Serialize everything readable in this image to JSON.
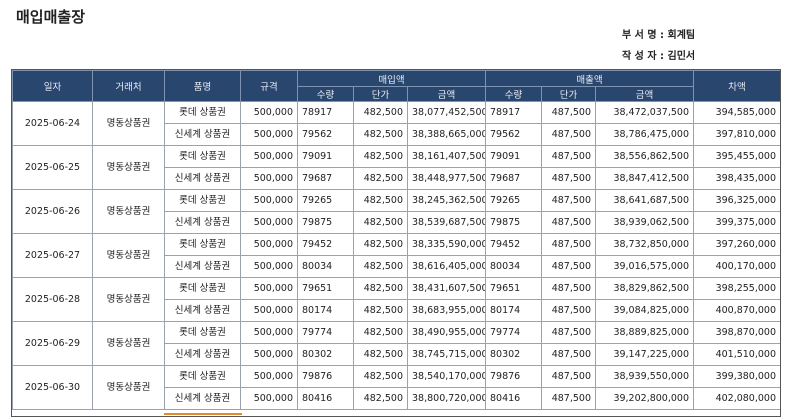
{
  "title": "매입매출장",
  "department": "부 서 명 : 회계팀",
  "author": "작 성 자 : 김민서",
  "headers": {
    "date": "일자",
    "vendor": "거래처",
    "item": "품명",
    "spec": "규격",
    "purchase": "매입액",
    "sales": "매출액",
    "margin": "차액",
    "qty": "수량",
    "unit_price": "단가",
    "amount": "금액"
  },
  "rows": [
    {
      "date": "2025-06-24",
      "vendor": "명동상품권",
      "items": [
        {
          "name": "롯데 상품권",
          "spec": "500,000",
          "p_qty": "78917",
          "p_price": "482,500",
          "p_amt": "38,077,452,500",
          "s_qty": "78917",
          "s_price": "487,500",
          "s_amt": "38,472,037,500",
          "margin": "394,585,000"
        },
        {
          "name": "신세계 상품권",
          "spec": "500,000",
          "p_qty": "79562",
          "p_price": "482,500",
          "p_amt": "38,388,665,000",
          "s_qty": "79562",
          "s_price": "487,500",
          "s_amt": "38,786,475,000",
          "margin": "397,810,000"
        }
      ]
    },
    {
      "date": "2025-06-25",
      "vendor": "명동상품권",
      "items": [
        {
          "name": "롯데 상품권",
          "spec": "500,000",
          "p_qty": "79091",
          "p_price": "482,500",
          "p_amt": "38,161,407,500",
          "s_qty": "79091",
          "s_price": "487,500",
          "s_amt": "38,556,862,500",
          "margin": "395,455,000"
        },
        {
          "name": "신세계 상품권",
          "spec": "500,000",
          "p_qty": "79687",
          "p_price": "482,500",
          "p_amt": "38,448,977,500",
          "s_qty": "79687",
          "s_price": "487,500",
          "s_amt": "38,847,412,500",
          "margin": "398,435,000"
        }
      ]
    },
    {
      "date": "2025-06-26",
      "vendor": "명동상품권",
      "items": [
        {
          "name": "롯데 상품권",
          "spec": "500,000",
          "p_qty": "79265",
          "p_price": "482,500",
          "p_amt": "38,245,362,500",
          "s_qty": "79265",
          "s_price": "487,500",
          "s_amt": "38,641,687,500",
          "margin": "396,325,000"
        },
        {
          "name": "신세계 상품권",
          "spec": "500,000",
          "p_qty": "79875",
          "p_price": "482,500",
          "p_amt": "38,539,687,500",
          "s_qty": "79875",
          "s_price": "487,500",
          "s_amt": "38,939,062,500",
          "margin": "399,375,000"
        }
      ]
    },
    {
      "date": "2025-06-27",
      "vendor": "명동상품권",
      "items": [
        {
          "name": "롯데 상품권",
          "spec": "500,000",
          "p_qty": "79452",
          "p_price": "482,500",
          "p_amt": "38,335,590,000",
          "s_qty": "79452",
          "s_price": "487,500",
          "s_amt": "38,732,850,000",
          "margin": "397,260,000"
        },
        {
          "name": "신세계 상품권",
          "spec": "500,000",
          "p_qty": "80034",
          "p_price": "482,500",
          "p_amt": "38,616,405,000",
          "s_qty": "80034",
          "s_price": "487,500",
          "s_amt": "39,016,575,000",
          "margin": "400,170,000"
        }
      ]
    },
    {
      "date": "2025-06-28",
      "vendor": "명동상품권",
      "items": [
        {
          "name": "롯데 상품권",
          "spec": "500,000",
          "p_qty": "79651",
          "p_price": "482,500",
          "p_amt": "38,431,607,500",
          "s_qty": "79651",
          "s_price": "487,500",
          "s_amt": "38,829,862,500",
          "margin": "398,255,000"
        },
        {
          "name": "신세계 상품권",
          "spec": "500,000",
          "p_qty": "80174",
          "p_price": "482,500",
          "p_amt": "38,683,955,000",
          "s_qty": "80174",
          "s_price": "487,500",
          "s_amt": "39,084,825,000",
          "margin": "400,870,000"
        }
      ]
    },
    {
      "date": "2025-06-29",
      "vendor": "명동상품권",
      "items": [
        {
          "name": "롯데 상품권",
          "spec": "500,000",
          "p_qty": "79774",
          "p_price": "482,500",
          "p_amt": "38,490,955,000",
          "s_qty": "79774",
          "s_price": "487,500",
          "s_amt": "38,889,825,000",
          "margin": "398,870,000"
        },
        {
          "name": "신세계 상품권",
          "spec": "500,000",
          "p_qty": "80302",
          "p_price": "482,500",
          "p_amt": "38,745,715,000",
          "s_qty": "80302",
          "s_price": "487,500",
          "s_amt": "39,147,225,000",
          "margin": "401,510,000"
        }
      ]
    },
    {
      "date": "2025-06-30",
      "vendor": "명동상품권",
      "items": [
        {
          "name": "롯데 상품권",
          "spec": "500,000",
          "p_qty": "79876",
          "p_price": "482,500",
          "p_amt": "38,540,170,000",
          "s_qty": "79876",
          "s_price": "487,500",
          "s_amt": "38,939,550,000",
          "margin": "399,380,000"
        },
        {
          "name": "신세계 상품권",
          "spec": "500,000",
          "p_qty": "80416",
          "p_price": "482,500",
          "p_amt": "38,800,720,000",
          "s_qty": "80416",
          "s_price": "487,500",
          "s_amt": "39,202,800,000",
          "margin": "402,080,000"
        }
      ]
    }
  ]
}
